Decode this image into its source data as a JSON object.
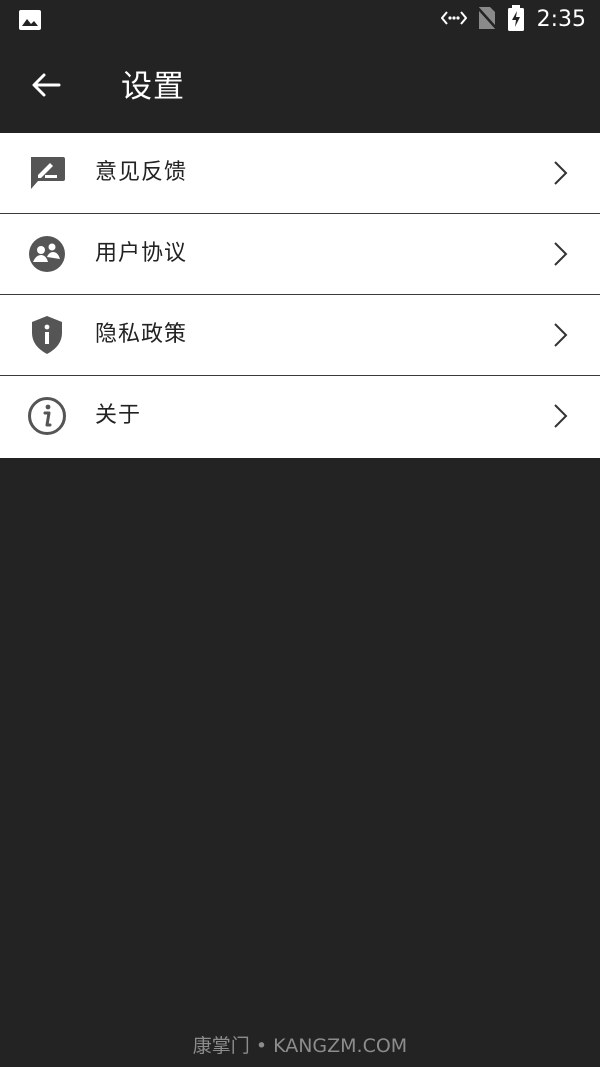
{
  "status_bar": {
    "time": "2:35",
    "icons": [
      "image-icon",
      "data-transfer-icon",
      "no-sim-icon",
      "battery-charging-icon"
    ]
  },
  "header": {
    "title": "设置",
    "back_icon": "back-arrow-icon"
  },
  "settings": {
    "items": [
      {
        "label": "意见反馈",
        "icon": "feedback-icon"
      },
      {
        "label": "用户协议",
        "icon": "user-agreement-icon"
      },
      {
        "label": "隐私政策",
        "icon": "privacy-shield-icon"
      },
      {
        "label": "关于",
        "icon": "info-icon"
      }
    ],
    "chevron_icon": "chevron-right-icon"
  },
  "watermark": {
    "text": "康掌门 • KANGZM.COM"
  },
  "colors": {
    "background": "#232323",
    "list_background": "#ffffff",
    "icon_gray": "#555555",
    "text_dark": "#222222",
    "watermark": "#8c8c8c"
  }
}
